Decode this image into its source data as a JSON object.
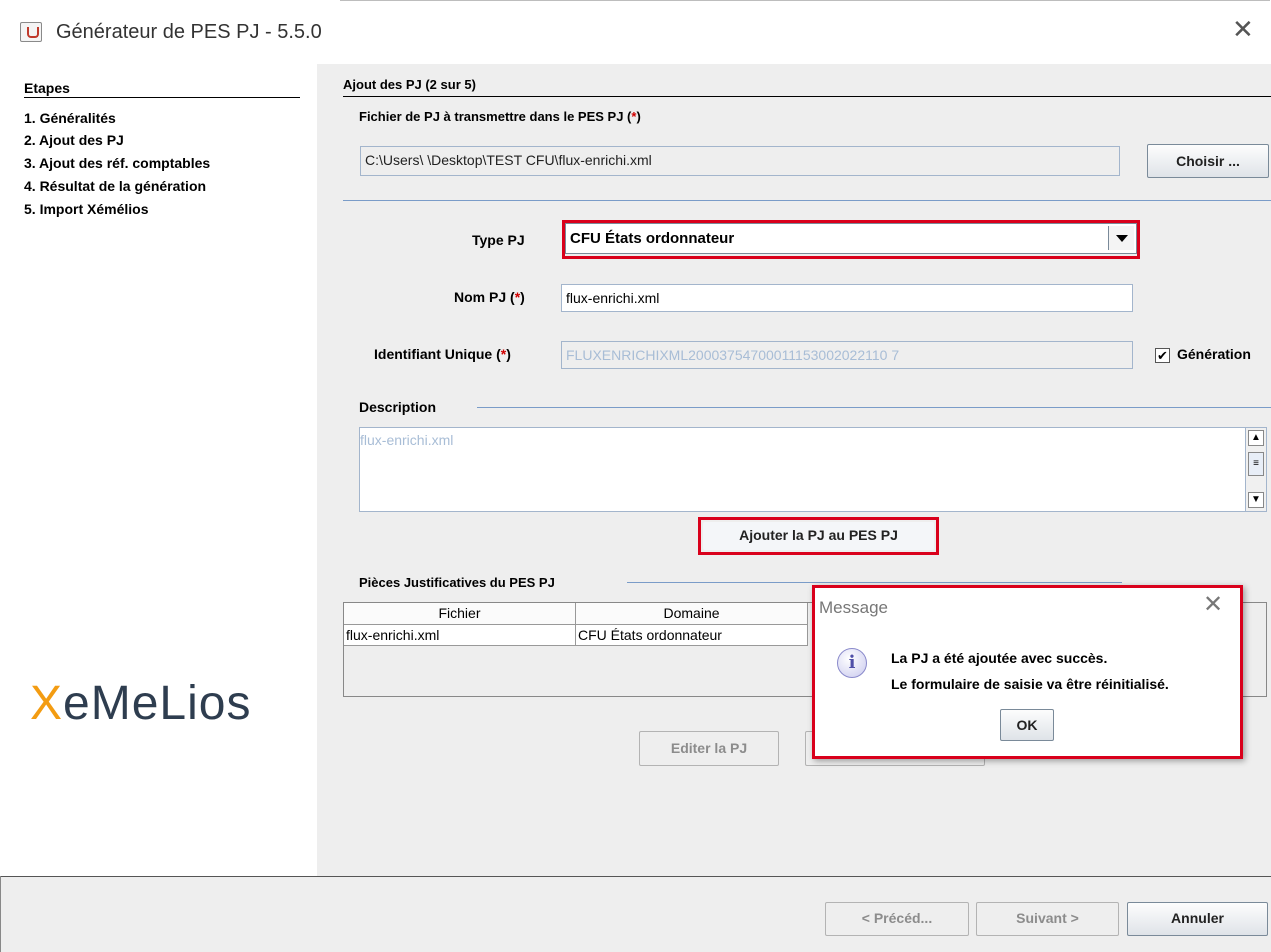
{
  "window": {
    "title": "Générateur de PES PJ - 5.5.0"
  },
  "sidebar": {
    "heading": "Etapes",
    "steps": [
      "1. Généralités",
      "2. Ajout des PJ",
      "3. Ajout des réf. comptables",
      "4. Résultat de la génération",
      "5. Import Xémélios"
    ],
    "logo_x": "X",
    "logo_rest": "eMeLios"
  },
  "main": {
    "section_title": "Ajout des PJ (2 sur 5)",
    "file_label": "Fichier de PJ à transmettre dans le PES PJ (",
    "required_mark": "*",
    "close_paren": ")",
    "file_path": "C:\\Users\\        \\Desktop\\TEST CFU\\flux-enrichi.xml",
    "choose_button": "Choisir ...",
    "type_pj_label": "Type PJ",
    "type_pj_value": "CFU États ordonnateur",
    "nom_pj_label": "Nom PJ (",
    "nom_pj_value": "flux-enrichi.xml",
    "id_label": "Identifiant Unique (",
    "id_value": "FLUXENRICHIXML20003754700011153002022110 7",
    "generation_label": "Génération",
    "generation_checked": "✔",
    "description_label": "Description",
    "description_value": "flux-enrichi.xml",
    "add_button": "Ajouter la PJ au PES PJ",
    "pieces_title": "Pièces Justificatives du PES PJ",
    "table": {
      "headers": [
        "Fichier",
        "Domaine"
      ],
      "rows": [
        [
          "flux-enrichi.xml",
          "CFU États ordonnateur"
        ]
      ]
    },
    "edit_button": "Editer la PJ"
  },
  "dialog": {
    "title": "Message",
    "line1": "La PJ a été ajoutée avec succès.",
    "line2": "Le formulaire de saisie va être réinitialisé.",
    "ok": "OK",
    "info_glyph": "i"
  },
  "footer": {
    "prev": "< Précéd...",
    "next": "Suivant >",
    "cancel": "Annuler"
  },
  "colors": {
    "highlight": "#d9001b",
    "panel": "#eeeeee",
    "disabled_text": "#a8bdd6"
  }
}
